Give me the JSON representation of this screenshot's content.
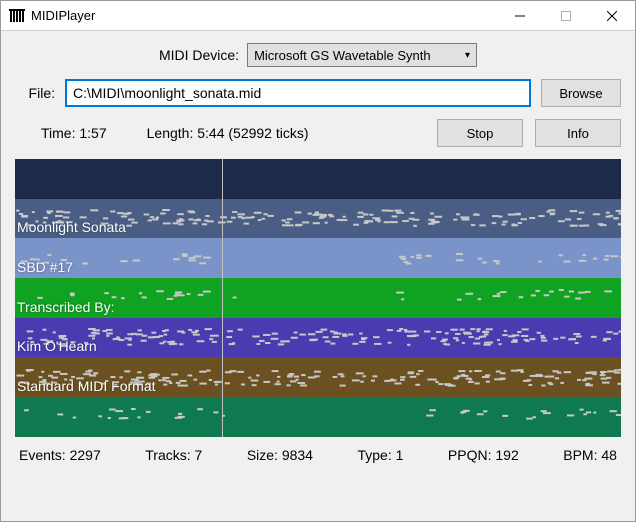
{
  "window": {
    "title": "MIDIPlayer"
  },
  "device": {
    "label": "MIDI Device:",
    "selected": "Microsoft GS Wavetable Synth"
  },
  "file": {
    "label": "File:",
    "value": "C:\\MIDI\\moonlight_sonata.mid",
    "browse": "Browse"
  },
  "status": {
    "time_label": "Time:",
    "time_value": "1:57",
    "length_label": "Length:",
    "length_value": "5:44 (52992 ticks)",
    "stop": "Stop",
    "info": "Info"
  },
  "tracks": [
    {
      "color": "#1e2a4a",
      "label": ""
    },
    {
      "color": "#4a5e85",
      "label": "Moonlight Sonata"
    },
    {
      "color": "#7a93c9",
      "label": "SBD #17"
    },
    {
      "color": "#10a321",
      "label": "Transcribed By:"
    },
    {
      "color": "#4a3bb0",
      "label": "Kim O'Hearn"
    },
    {
      "color": "#6b5121",
      "label": "Standard MIDI Format"
    },
    {
      "color": "#0f7a4f",
      "label": ""
    }
  ],
  "playhead_fraction": 0.341,
  "footer": {
    "events_label": "Events:",
    "events_value": "2297",
    "tracks_label": "Tracks:",
    "tracks_value": "7",
    "size_label": "Size:",
    "size_value": "9834",
    "type_label": "Type:",
    "type_value": "1",
    "ppqn_label": "PPQN:",
    "ppqn_value": "192",
    "bpm_label": "BPM:",
    "bpm_value": "48"
  }
}
